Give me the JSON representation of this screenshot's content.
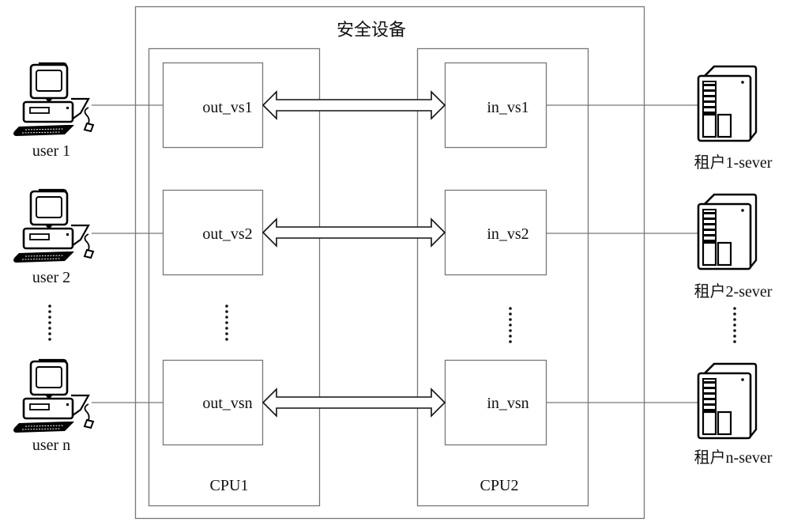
{
  "device": {
    "title": "安全设备",
    "cpus": [
      {
        "label": "CPU1",
        "modules": [
          "out_vs1",
          "out_vs2",
          "out_vsn"
        ]
      },
      {
        "label": "CPU2",
        "modules": [
          "in_vs1",
          "in_vs2",
          "in_vsn"
        ]
      }
    ],
    "ellipsis": "……"
  },
  "users": [
    {
      "label": "user 1",
      "icon": "computer-icon"
    },
    {
      "label": "user 2",
      "icon": "computer-icon"
    },
    {
      "label": "user n",
      "icon": "computer-icon"
    }
  ],
  "servers": [
    {
      "label": "租户1-sever",
      "icon": "server-icon"
    },
    {
      "label": "租户2-sever",
      "icon": "server-icon"
    },
    {
      "label": "租户n-sever",
      "icon": "server-icon"
    }
  ],
  "connections": {
    "arrow_type": "bidirectional-hollow-arrow",
    "pairs": [
      [
        "out_vs1",
        "in_vs1"
      ],
      [
        "out_vs2",
        "in_vs2"
      ],
      [
        "out_vsn",
        "in_vsn"
      ]
    ]
  }
}
